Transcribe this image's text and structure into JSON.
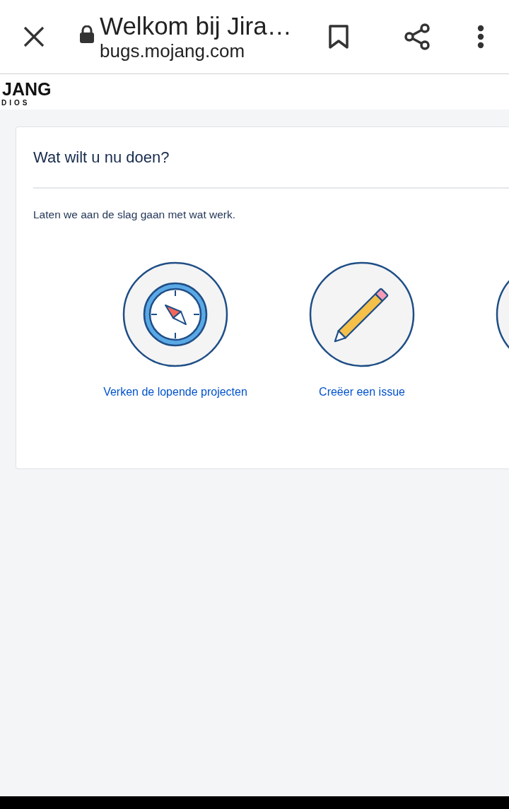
{
  "browser_bar": {
    "title": "Welkom bij Jira…",
    "url": "bugs.mojang.com"
  },
  "logo": {
    "wordmark": "JANG",
    "subtitle": "DIOS"
  },
  "card": {
    "title": "Wat wilt u nu doen?",
    "intro": "Laten we aan de slag gaan met wat werk.",
    "actions": [
      {
        "kind": "compass",
        "label": "Verken de lopende projecten"
      },
      {
        "kind": "pencil",
        "label": "Creëer een issue"
      }
    ]
  }
}
